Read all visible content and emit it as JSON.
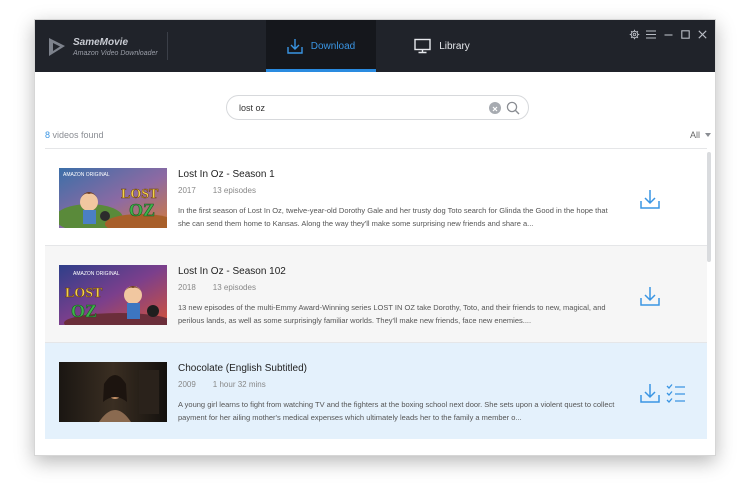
{
  "app": {
    "name": "SameMovie",
    "subtitle": "Amazon Video Downloader"
  },
  "nav": {
    "tabs": [
      {
        "label": "Download",
        "icon": "download-tab-icon",
        "active": true
      },
      {
        "label": "Library",
        "icon": "monitor-icon",
        "active": false
      }
    ]
  },
  "window_controls": [
    "gear-icon",
    "menu-icon",
    "minimize-icon",
    "maximize-icon",
    "close-icon"
  ],
  "search": {
    "value": "lost oz"
  },
  "results": {
    "count": "8",
    "suffix": " videos found",
    "filter": "All"
  },
  "items": [
    {
      "title": "Lost In Oz - Season 1",
      "year": "2017",
      "info": "13 episodes",
      "description": "In the first season of Lost In Oz, twelve-year-old Dorothy Gale and her trusty dog Toto search for Glinda the Good in the hope that she can send them home to Kansas. Along the way they'll make some surprising new friends and share a...",
      "thumb_badge": "AMAZON ORIGINAL",
      "thumb_logo_top": "LOST",
      "thumb_logo_bottom": "OZ"
    },
    {
      "title": "Lost In Oz - Season 102",
      "year": "2018",
      "info": "13 episodes",
      "description": "13 new episodes of the multi-Emmy Award-Winning series LOST IN OZ take Dorothy, Toto, and their friends to new, magical, and perilous lands, as well as some surprisingly familiar worlds. They'll make new friends, face new enemies....",
      "thumb_badge": "AMAZON ORIGINAL",
      "thumb_logo_top": "LOST",
      "thumb_logo_bottom": "OZ"
    },
    {
      "title": "Chocolate (English Subtitled)",
      "year": "2009",
      "info": "1 hour 32 mins",
      "description": "A young girl learns to fight from watching TV and the fighters at the boxing school next door. She sets upon a violent quest to collect payment for her ailing mother's medical expenses which ultimately leads her to the family a member o..."
    }
  ],
  "colors": {
    "titlebar": "#20232a",
    "accent": "#2a8be0",
    "selected_row": "#e4f1fc"
  }
}
